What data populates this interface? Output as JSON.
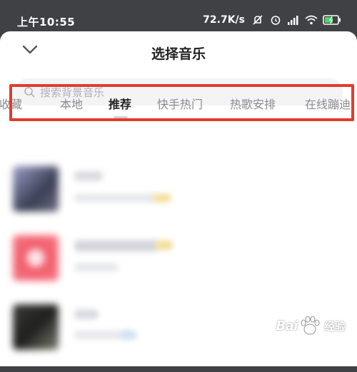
{
  "status_bar": {
    "time": "上午10:55",
    "network_speed": "72.7K/s",
    "icons": [
      "mute-icon",
      "alarm-icon",
      "signal-icon",
      "wifi-icon",
      "battery-icon"
    ]
  },
  "header": {
    "title": "选择音乐",
    "back_icon": "chevron-down-icon"
  },
  "search": {
    "placeholder": "搜索背景音乐",
    "icon": "search-icon"
  },
  "tabs": [
    {
      "label": "收藏",
      "active": false
    },
    {
      "label": "本地",
      "active": false
    },
    {
      "label": "推荐",
      "active": true
    },
    {
      "label": "快手热门",
      "active": false
    },
    {
      "label": "热歌安排",
      "active": false
    },
    {
      "label": "在线蹦迪",
      "active": false
    }
  ],
  "highlight_color": "#e23b2c",
  "watermark": {
    "logo_text": "Bai",
    "suffix": "经验"
  }
}
